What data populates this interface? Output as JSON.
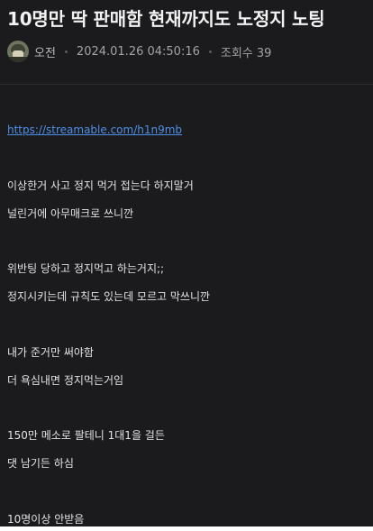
{
  "post": {
    "title": "10명만 딱 판매함 현재까지도 노정지 노팅",
    "author": "오전",
    "date": "2024.01.26 04:50:16",
    "views_label": "조회수 39"
  },
  "body": {
    "link": "https://streamable.com/h1n9mb",
    "lines": [
      "이상한거 사고 정지 먹거 접는다 하지말거",
      "널린거에 아무매크로 쓰니깐",
      "위반팅 당하고 정지먹고 하는거지;;",
      "정지시키는데 규칙도 있는데 모르고 막쓰니깐",
      "내가 준거만 써야함",
      "더 욕심내면 정지먹는거임",
      "150만 메소로 팔테니 1대1을 걸든",
      "댓 남기든 하심",
      "10명이상 안받음"
    ]
  }
}
